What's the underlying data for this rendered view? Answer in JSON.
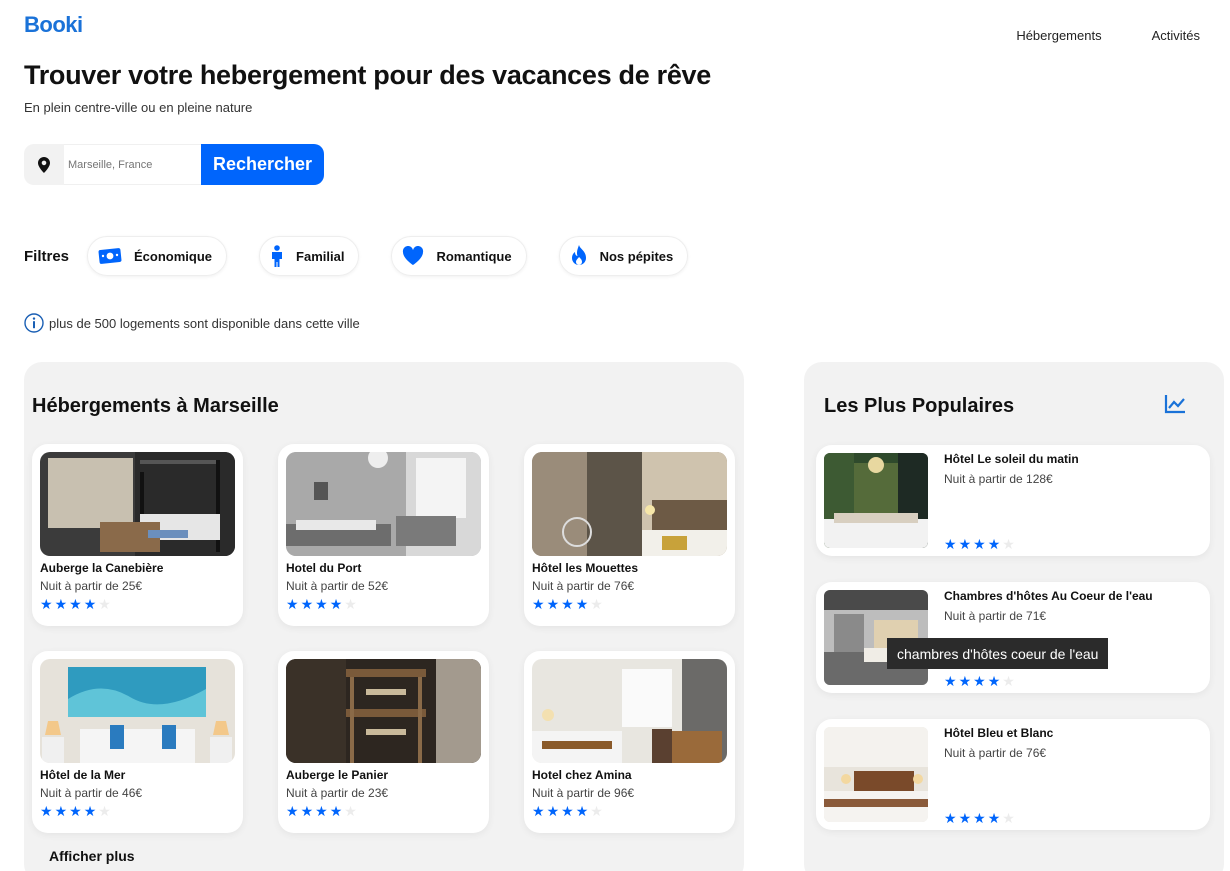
{
  "header": {
    "logo": "Booki",
    "nav": [
      "Hébergements",
      "Activités"
    ]
  },
  "hero": {
    "title": "Trouver votre hebergement pour des vacances de rêve",
    "subtitle": "En plein centre-ville ou en pleine nature"
  },
  "search": {
    "placeholder": "Marseille, France",
    "button": "Rechercher",
    "icon": "location-pin-icon"
  },
  "filters": {
    "label": "Filtres",
    "items": [
      {
        "label": "Économique",
        "icon": "money-icon"
      },
      {
        "label": "Familial",
        "icon": "child-icon"
      },
      {
        "label": "Romantique",
        "icon": "heart-icon"
      },
      {
        "label": "Nos pépites",
        "icon": "fire-icon"
      }
    ]
  },
  "info": {
    "text": "plus de 500 logements sont disponible dans cette ville",
    "icon": "info-icon"
  },
  "listings": {
    "title": "Hébergements à Marseille",
    "more": "Afficher plus",
    "items": [
      {
        "name": "Auberge la Canebière",
        "price": "Nuit à partir de 25€",
        "rating": 4
      },
      {
        "name": "Hotel du Port",
        "price": "Nuit à partir de 52€",
        "rating": 4
      },
      {
        "name": "Hôtel les Mouettes",
        "price": "Nuit à partir de 76€",
        "rating": 4
      },
      {
        "name": "Hôtel de la Mer",
        "price": "Nuit à partir de 46€",
        "rating": 4
      },
      {
        "name": "Auberge le Panier",
        "price": "Nuit à partir de 23€",
        "rating": 4
      },
      {
        "name": "Hotel chez Amina",
        "price": "Nuit à partir de 96€",
        "rating": 4
      }
    ]
  },
  "popular": {
    "title": "Les Plus Populaires",
    "icon": "trend-chart-icon",
    "items": [
      {
        "name": "Hôtel Le soleil du matin",
        "price": "Nuit à partir de 128€",
        "rating": 4
      },
      {
        "name": "Chambres d'hôtes Au Coeur de l'eau",
        "price": "Nuit à partir de 71€",
        "rating": 4
      },
      {
        "name": "Hôtel Bleu et Blanc",
        "price": "Nuit à partir de 76€",
        "rating": 4
      }
    ]
  },
  "tooltip": "chambres d'hôtes coeur de l'eau",
  "colors": {
    "accent": "#0065fc",
    "panel": "#f2f2f2"
  }
}
